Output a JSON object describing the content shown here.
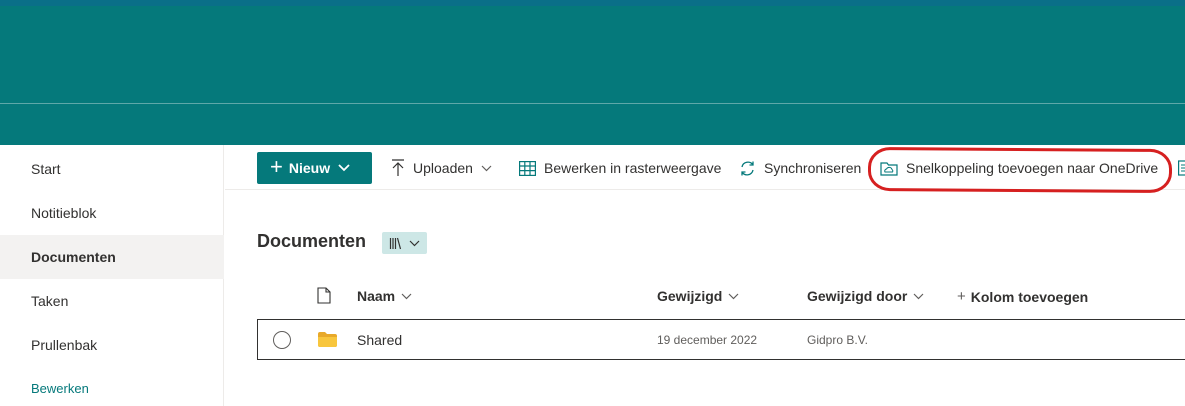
{
  "sidebar": {
    "items": [
      {
        "label": "Start"
      },
      {
        "label": "Notitieblok"
      },
      {
        "label": "Documenten"
      },
      {
        "label": "Taken"
      },
      {
        "label": "Prullenbak"
      }
    ],
    "edit_label": "Bewerken"
  },
  "toolbar": {
    "new_label": "Nieuw",
    "upload_label": "Uploaden",
    "grid_edit_label": "Bewerken in rasterweergave",
    "sync_label": "Synchroniseren",
    "shortcut_label": "Snelkoppeling toevoegen naar OneDrive"
  },
  "library": {
    "title": "Documenten"
  },
  "columns": {
    "name": "Naam",
    "modified": "Gewijzigd",
    "modified_by": "Gewijzigd door",
    "add_column": "Kolom toevoegen"
  },
  "rows": [
    {
      "name": "Shared",
      "modified": "19 december 2022",
      "modified_by": "Gidpro B.V."
    }
  ],
  "colors": {
    "brand": "#05797b",
    "banner_strip": "#0a6f88",
    "annotation": "#d62020",
    "folder": "#f8c63d"
  }
}
